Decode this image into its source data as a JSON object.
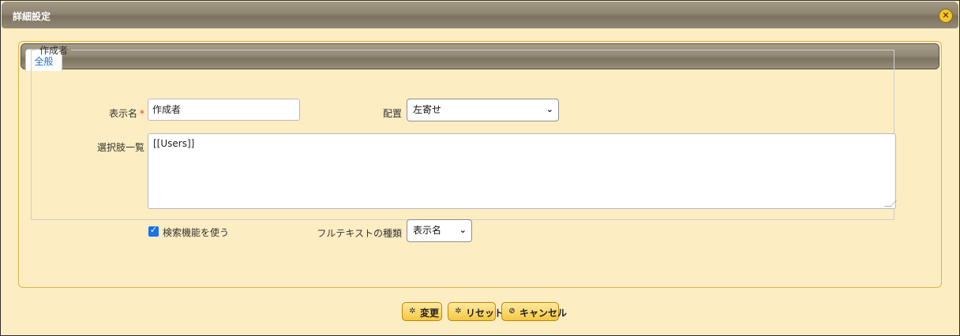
{
  "dialog": {
    "title": "詳細設定",
    "close_icon": "close-icon"
  },
  "tabs": [
    {
      "label": "全般",
      "active": true
    }
  ],
  "group": {
    "legend": "作成者",
    "display_name": {
      "label": "表示名",
      "required_mark": "*",
      "value": "作成者"
    },
    "alignment": {
      "label": "配置",
      "selected": "左寄せ",
      "icon": "chevron-down-icon"
    },
    "choices": {
      "label": "選択肢一覧",
      "value": "[[Users]]"
    },
    "search": {
      "label": "検索機能を使う",
      "checked": true
    },
    "fulltext": {
      "label": "フルテキストの種類",
      "selected": "表示名",
      "icon": "chevron-down-icon"
    }
  },
  "buttons": {
    "change": {
      "label": "変更",
      "icon": "gear-icon"
    },
    "reset": {
      "label": "リセット",
      "icon": "gear-icon"
    },
    "cancel": {
      "label": "キャンセル",
      "icon": "cancel-icon"
    }
  },
  "colors": {
    "dialog_bg": "#fdedc2",
    "titlebar": "#8e8470",
    "button": "#f5c842",
    "tab_text": "#1b74c9",
    "required": "#e53935",
    "checkbox": "#1a73e8"
  }
}
